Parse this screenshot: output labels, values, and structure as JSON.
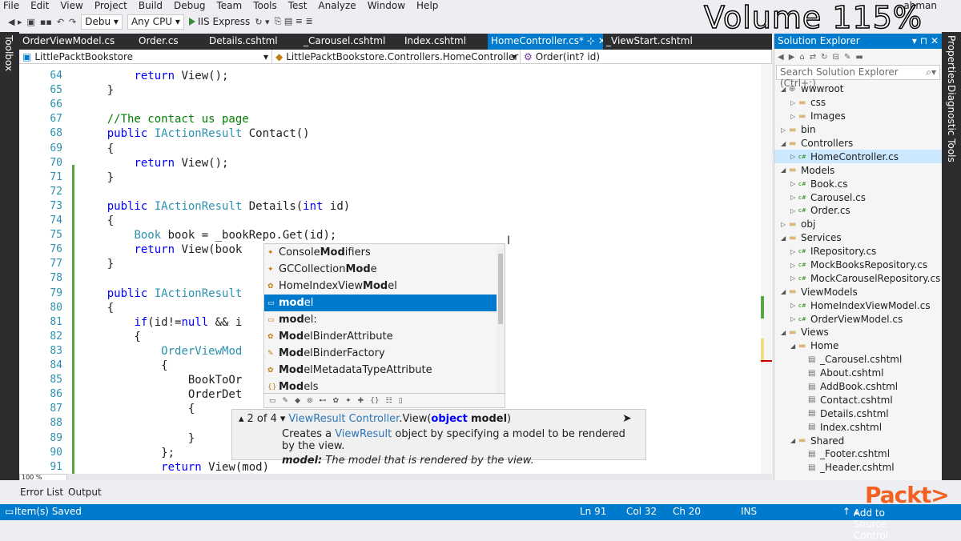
{
  "menu": [
    "File",
    "Edit",
    "View",
    "Project",
    "Build",
    "Debug",
    "Team",
    "Tools",
    "Test",
    "Analyze",
    "Window",
    "Help"
  ],
  "toolbar": {
    "config": "Debu",
    "platform": "Any CPU",
    "run_label": "IIS Express"
  },
  "overlay": {
    "volume": "Volume 115%",
    "user_fragment": "ahman"
  },
  "left_strip": {
    "toolbox": "Toolbox"
  },
  "right_strip": {
    "properties": "Properties",
    "diagnostic": "Diagnostic Tools"
  },
  "tabs": [
    {
      "label": "OrderViewModel.cs",
      "active": false
    },
    {
      "label": "Order.cs",
      "active": false
    },
    {
      "label": "Details.cshtml",
      "active": false
    },
    {
      "label": "_Carousel.cshtml",
      "active": false
    },
    {
      "label": "Index.cshtml",
      "active": false
    },
    {
      "label": "HomeController.cs*",
      "active": true
    },
    {
      "label": "_ViewStart.cshtml",
      "active": false
    }
  ],
  "navbar": {
    "project": "LittlePacktBookstore",
    "class": "LittlePacktBookstore.Controllers.HomeController",
    "member": "Order(int? id)"
  },
  "code_lines": [
    {
      "num": "64",
      "text": "        return View();"
    },
    {
      "num": "65",
      "text": "    }"
    },
    {
      "num": "66",
      "text": ""
    },
    {
      "num": "67",
      "text": "    //The contact us page"
    },
    {
      "num": "68",
      "text": "    public IActionResult Contact()"
    },
    {
      "num": "69",
      "text": "    {"
    },
    {
      "num": "70",
      "text": "        return View();"
    },
    {
      "num": "71",
      "text": "    }"
    },
    {
      "num": "72",
      "text": ""
    },
    {
      "num": "73",
      "text": "    public IActionResult Details(int id)"
    },
    {
      "num": "74",
      "text": "    {"
    },
    {
      "num": "75",
      "text": "        Book book = _bookRepo.Get(id);"
    },
    {
      "num": "76",
      "text": "        return View(book"
    },
    {
      "num": "77",
      "text": "    }"
    },
    {
      "num": "78",
      "text": ""
    },
    {
      "num": "79",
      "text": "    public IActionResult"
    },
    {
      "num": "80",
      "text": "    {"
    },
    {
      "num": "81",
      "text": "        if(id!=null && i"
    },
    {
      "num": "82",
      "text": "        {"
    },
    {
      "num": "83",
      "text": "            OrderViewMod"
    },
    {
      "num": "84",
      "text": "            {"
    },
    {
      "num": "85",
      "text": "                BookToOr"
    },
    {
      "num": "86",
      "text": "                OrderDet"
    },
    {
      "num": "87",
      "text": "                {"
    },
    {
      "num": "88",
      "text": ""
    },
    {
      "num": "89",
      "text": "                }"
    },
    {
      "num": "90",
      "text": "            };"
    },
    {
      "num": "91",
      "text": "            return View(mod)"
    }
  ],
  "autocomplete": {
    "items": [
      {
        "pre": "Console",
        "bold": "Mod",
        "post": "ifiers",
        "icon": "enum-icon",
        "selected": false
      },
      {
        "pre": "GCCollection",
        "bold": "Mod",
        "post": "e",
        "icon": "enum-icon",
        "selected": false
      },
      {
        "pre": "HomeIndexView",
        "bold": "Mod",
        "post": "el",
        "icon": "class-icon",
        "selected": false
      },
      {
        "pre": "",
        "bold": "mod",
        "post": "el",
        "icon": "local-icon",
        "selected": true
      },
      {
        "pre": "",
        "bold": "mod",
        "post": "el:",
        "icon": "local-icon",
        "selected": false
      },
      {
        "pre": "",
        "bold": "Mod",
        "post": "elBinderAttribute",
        "icon": "class-icon",
        "selected": false
      },
      {
        "pre": "",
        "bold": "Mod",
        "post": "elBinderFactory",
        "icon": "wrench-icon",
        "selected": false
      },
      {
        "pre": "",
        "bold": "Mod",
        "post": "elMetadataTypeAttribute",
        "icon": "class-icon",
        "selected": false
      },
      {
        "pre": "",
        "bold": "Mod",
        "post": "els",
        "icon": "namespace-icon",
        "selected": false
      }
    ]
  },
  "tooltip": {
    "counter": "2 of 4",
    "return_type": "ViewResult",
    "class_name": "Controller",
    "method": ".View(",
    "param_type": "object",
    "param_name": "model",
    "close": ")",
    "desc_pre": "Creates a ",
    "desc_link": "ViewResult",
    "desc_post": " object by specifying a model to be rendered by the view.",
    "param_label": "model:",
    "param_desc": " The model that is rendered by the view."
  },
  "solution_explorer": {
    "title": "Solution Explorer",
    "search_placeholder": "Search Solution Explorer (Ctrl+;)",
    "nodes": [
      {
        "label": "wwwroot",
        "depth": 1,
        "icon": "globe-icon",
        "expanded": true
      },
      {
        "label": "css",
        "depth": 2,
        "icon": "folder-icon",
        "expanded": false
      },
      {
        "label": "Images",
        "depth": 2,
        "icon": "folder-icon",
        "expanded": false
      },
      {
        "label": "bin",
        "depth": 1,
        "icon": "folder-icon",
        "expanded": false
      },
      {
        "label": "Controllers",
        "depth": 1,
        "icon": "folder-icon",
        "expanded": true
      },
      {
        "label": "HomeController.cs",
        "depth": 2,
        "icon": "csharp-icon",
        "expanded": false,
        "selected": true
      },
      {
        "label": "Models",
        "depth": 1,
        "icon": "folder-icon",
        "expanded": true
      },
      {
        "label": "Book.cs",
        "depth": 2,
        "icon": "csharp-icon",
        "expanded": false
      },
      {
        "label": "Carousel.cs",
        "depth": 2,
        "icon": "csharp-icon",
        "expanded": false
      },
      {
        "label": "Order.cs",
        "depth": 2,
        "icon": "csharp-icon",
        "expanded": false
      },
      {
        "label": "obj",
        "depth": 1,
        "icon": "folder-icon",
        "expanded": false
      },
      {
        "label": "Services",
        "depth": 1,
        "icon": "folder-icon",
        "expanded": true
      },
      {
        "label": "IRepository.cs",
        "depth": 2,
        "icon": "csharp-icon",
        "expanded": false
      },
      {
        "label": "MockBooksRepository.cs",
        "depth": 2,
        "icon": "csharp-icon",
        "expanded": false
      },
      {
        "label": "MockCarouselRepository.cs",
        "depth": 2,
        "icon": "csharp-icon",
        "expanded": false
      },
      {
        "label": "ViewModels",
        "depth": 1,
        "icon": "folder-icon",
        "expanded": true
      },
      {
        "label": "HomeIndexViewModel.cs",
        "depth": 2,
        "icon": "csharp-icon",
        "expanded": false
      },
      {
        "label": "OrderViewModel.cs",
        "depth": 2,
        "icon": "csharp-icon",
        "expanded": false
      },
      {
        "label": "Views",
        "depth": 1,
        "icon": "folder-icon",
        "expanded": true
      },
      {
        "label": "Home",
        "depth": 2,
        "icon": "folder-icon",
        "expanded": true
      },
      {
        "label": "_Carousel.cshtml",
        "depth": 3,
        "icon": "razor-icon",
        "expanded": false
      },
      {
        "label": "About.cshtml",
        "depth": 3,
        "icon": "razor-icon",
        "expanded": false
      },
      {
        "label": "AddBook.cshtml",
        "depth": 3,
        "icon": "razor-icon",
        "expanded": false
      },
      {
        "label": "Contact.cshtml",
        "depth": 3,
        "icon": "razor-icon",
        "expanded": false
      },
      {
        "label": "Details.cshtml",
        "depth": 3,
        "icon": "razor-icon",
        "expanded": false
      },
      {
        "label": "Index.cshtml",
        "depth": 3,
        "icon": "razor-icon",
        "expanded": false
      },
      {
        "label": "Shared",
        "depth": 2,
        "icon": "folder-icon",
        "expanded": true
      },
      {
        "label": "_Footer.cshtml",
        "depth": 3,
        "icon": "razor-icon",
        "expanded": false
      },
      {
        "label": "_Header.cshtml",
        "depth": 3,
        "icon": "razor-icon",
        "expanded": false
      }
    ]
  },
  "bottom_tabs": [
    "Error List",
    "Output"
  ],
  "zoom": "100 %",
  "status": {
    "message": "Item(s) Saved",
    "ln": "Ln 91",
    "col": "Col 32",
    "ch": "Ch 20",
    "mode": "INS",
    "source_control": "Add to Source Control"
  },
  "brand": "Packt>",
  "colors": {
    "accent": "#007acc",
    "tab_bar": "#2d2d30",
    "keyword": "#0000ff",
    "type": "#2b91af",
    "comment": "#008000"
  }
}
